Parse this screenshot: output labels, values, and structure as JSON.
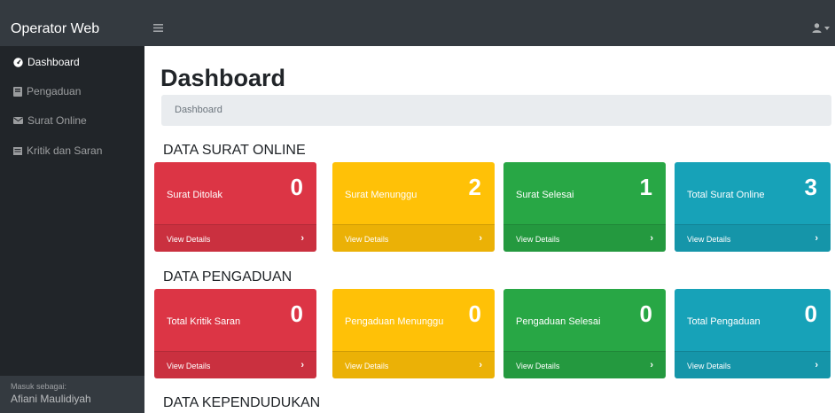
{
  "navbar": {
    "brand": "Operator Web",
    "toggle_icon": "menu-icon",
    "user_icon": "user-icon"
  },
  "sidebar": {
    "items": [
      {
        "label": "Dashboard",
        "icon": "tachometer-icon",
        "active": true
      },
      {
        "label": "Pengaduan",
        "icon": "book-icon",
        "active": false
      },
      {
        "label": "Surat Online",
        "icon": "envelope-icon",
        "active": false
      },
      {
        "label": "Kritik dan Saran",
        "icon": "list-icon",
        "active": false
      }
    ],
    "footer": {
      "label": "Masuk sebagai:",
      "user": "Afiani Maulidiyah"
    }
  },
  "main": {
    "title": "Dashboard",
    "breadcrumb": "Dashboard",
    "sections": [
      {
        "title": "DATA SURAT ONLINE",
        "cards": [
          {
            "label": "Surat Ditolak",
            "value": "0",
            "color": "#dc3545",
            "footer": "View Details"
          },
          {
            "label": "Surat Menunggu",
            "value": "2",
            "color": "#ffc107",
            "footer": "View Details"
          },
          {
            "label": "Surat Selesai",
            "value": "1",
            "color": "#28a745",
            "footer": "View Details"
          },
          {
            "label": "Total Surat Online",
            "value": "3",
            "color": "#17a2b8",
            "footer": "View Details"
          }
        ]
      },
      {
        "title": "DATA PENGADUAN",
        "cards": [
          {
            "label": "Total Kritik Saran",
            "value": "0",
            "color": "#dc3545",
            "footer": "View Details"
          },
          {
            "label": "Pengaduan Menunggu",
            "value": "0",
            "color": "#ffc107",
            "footer": "View Details"
          },
          {
            "label": "Pengaduan Selesai",
            "value": "0",
            "color": "#28a745",
            "footer": "View Details"
          },
          {
            "label": "Total Pengaduan",
            "value": "0",
            "color": "#17a2b8",
            "footer": "View Details"
          }
        ]
      },
      {
        "title": "DATA KEPENDUDUKAN",
        "cards": []
      }
    ]
  }
}
